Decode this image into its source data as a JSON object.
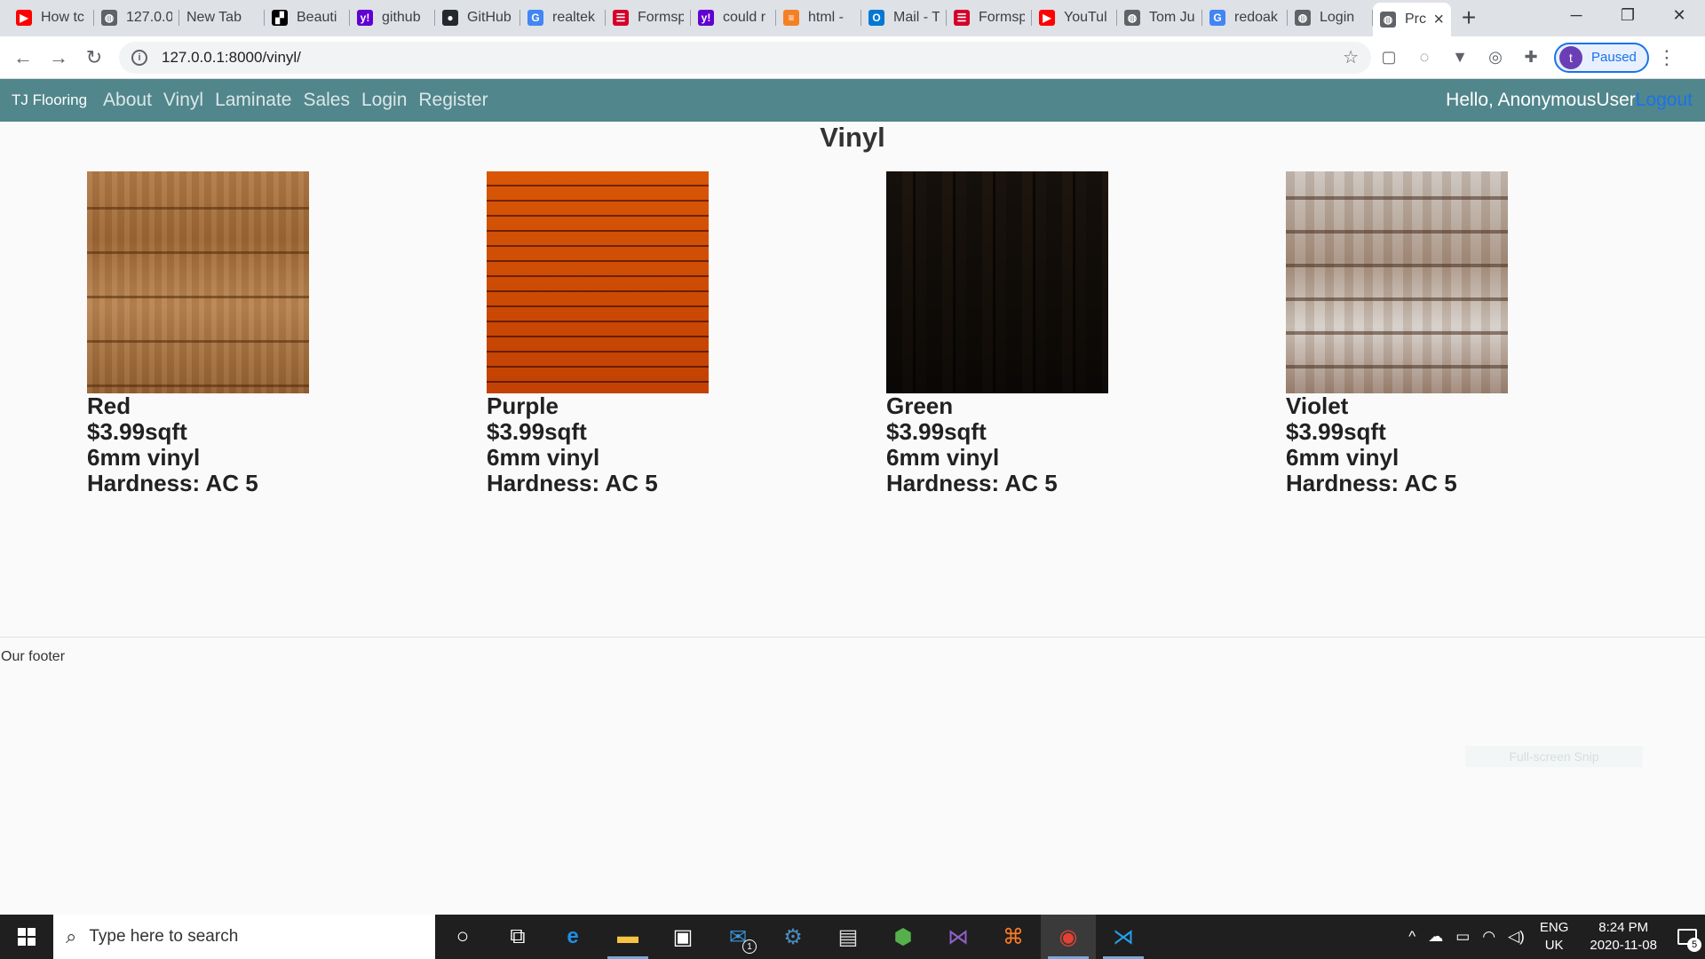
{
  "browser": {
    "tabs": [
      {
        "title": "How tc",
        "icon": "youtube-icon",
        "color": "#ff0000",
        "glyph": "▶"
      },
      {
        "title": "127.0.0",
        "icon": "globe-icon",
        "color": "#5f6368",
        "glyph": "◍"
      },
      {
        "title": "New Tab",
        "icon": "",
        "color": "",
        "glyph": ""
      },
      {
        "title": "Beauti",
        "icon": "crown-icon",
        "color": "#000000",
        "glyph": "▞"
      },
      {
        "title": "github",
        "icon": "yahoo-icon",
        "color": "#6001d2",
        "glyph": "y!"
      },
      {
        "title": "GitHub",
        "icon": "github-icon",
        "color": "#24292e",
        "glyph": "●"
      },
      {
        "title": "realtek",
        "icon": "google-icon",
        "color": "#4285f4",
        "glyph": "G"
      },
      {
        "title": "Formsp",
        "icon": "forms-icon",
        "color": "#d4002a",
        "glyph": "☰"
      },
      {
        "title": "could r",
        "icon": "yahoo-icon",
        "color": "#6001d2",
        "glyph": "y!"
      },
      {
        "title": "html -",
        "icon": "stackoverflow-icon",
        "color": "#f48024",
        "glyph": "≡"
      },
      {
        "title": "Mail - T",
        "icon": "outlook-icon",
        "color": "#0078d4",
        "glyph": "O"
      },
      {
        "title": "Formsp",
        "icon": "forms-icon",
        "color": "#d4002a",
        "glyph": "☰"
      },
      {
        "title": "YouTul",
        "icon": "youtube-icon",
        "color": "#ff0000",
        "glyph": "▶"
      },
      {
        "title": "Tom Ju",
        "icon": "globe-icon",
        "color": "#5f6368",
        "glyph": "◍"
      },
      {
        "title": "redoak",
        "icon": "google-icon",
        "color": "#4285f4",
        "glyph": "G"
      },
      {
        "title": "Login",
        "icon": "globe-icon",
        "color": "#5f6368",
        "glyph": "◍"
      },
      {
        "title": "Prc",
        "icon": "globe-icon",
        "color": "#5f6368",
        "glyph": "◍",
        "active": true
      }
    ],
    "url": "127.0.0.1:8000/vinyl/",
    "profile_initial": "t",
    "profile_status": "Paused"
  },
  "site": {
    "brand": "TJ Flooring",
    "nav": [
      "About",
      "Vinyl",
      "Laminate",
      "Sales",
      "Login",
      "Register"
    ],
    "greeting": "Hello, AnonymousUser",
    "logout": "Logout",
    "page_title": "Vinyl",
    "products": [
      {
        "name": "Red",
        "price": "$3.99sqft",
        "thickness": "6mm vinyl",
        "hardness": "Hardness: AC 5"
      },
      {
        "name": "Purple",
        "price": "$3.99sqft",
        "thickness": "6mm vinyl",
        "hardness": "Hardness: AC 5"
      },
      {
        "name": "Green",
        "price": "$3.99sqft",
        "thickness": "6mm vinyl",
        "hardness": "Hardness: AC 5"
      },
      {
        "name": "Violet",
        "price": "$3.99sqft",
        "thickness": "6mm vinyl",
        "hardness": "Hardness: AC 5"
      }
    ],
    "footer": "Our footer",
    "snip_overlay": "Full-screen Snip"
  },
  "taskbar": {
    "search_placeholder": "Type here to search",
    "mail_badge": "1",
    "lang_top": "ENG",
    "lang_bottom": "UK",
    "time": "8:24 PM",
    "date": "2020-11-08",
    "notifications": "5"
  },
  "colors": {
    "site_nav": "#51868c",
    "logout_link": "#1a73e8",
    "taskbar": "#1f1f1f"
  }
}
